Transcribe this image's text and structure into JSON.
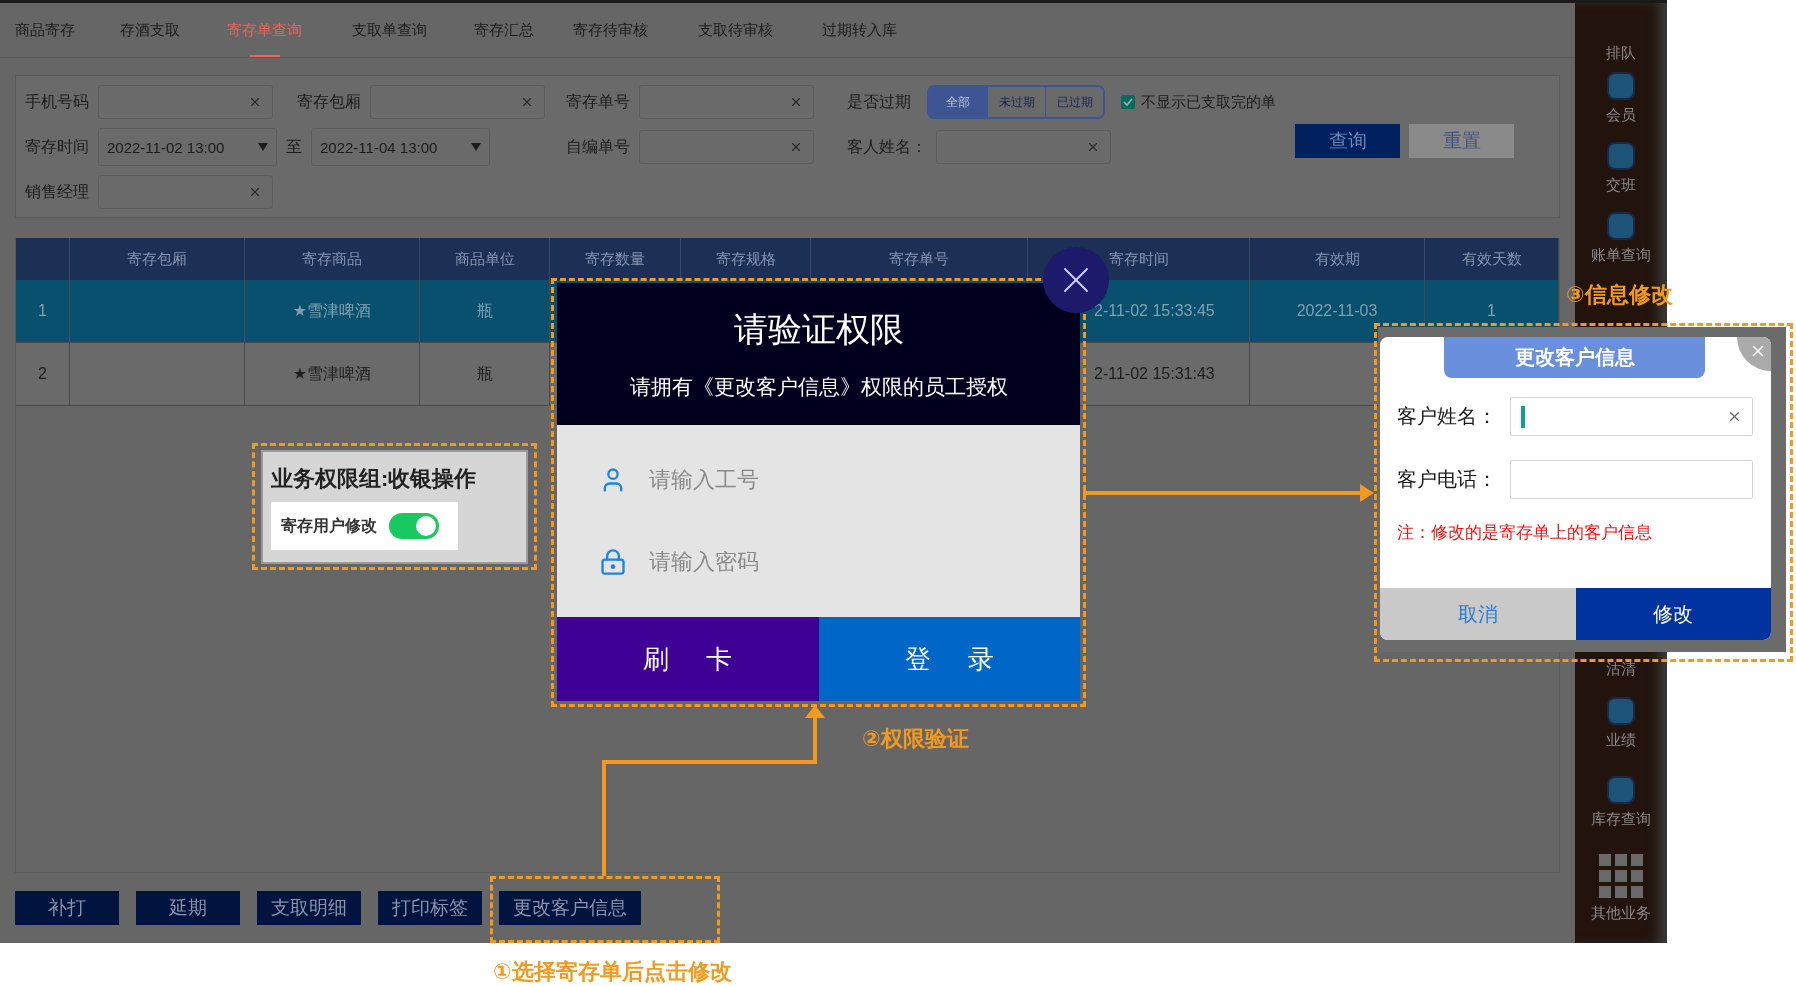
{
  "tabs": [
    {
      "label": "商品寄存",
      "selected": false
    },
    {
      "label": "存酒支取",
      "selected": false
    },
    {
      "label": "寄存单查询",
      "selected": true
    },
    {
      "label": "支取单查询",
      "selected": false
    },
    {
      "label": "寄存汇总",
      "selected": false
    },
    {
      "label": "寄存待审核",
      "selected": false
    },
    {
      "label": "支取待审核",
      "selected": false
    },
    {
      "label": "过期转入库",
      "selected": false
    }
  ],
  "filters": {
    "phone": {
      "label": "手机号码"
    },
    "room": {
      "label": "寄存包厢"
    },
    "order_no": {
      "label": "寄存单号"
    },
    "expired": {
      "label": "是否过期",
      "options": [
        {
          "label": "全部",
          "selected": true
        },
        {
          "label": "未过期",
          "selected": false
        },
        {
          "label": "已过期",
          "selected": false
        }
      ]
    },
    "hide_done": {
      "label": "不显示已支取完的单",
      "checked": true
    },
    "time": {
      "label": "寄存时间",
      "from": "2022-11-02 13:00",
      "separator": "至",
      "to": "2022-11-04 13:00"
    },
    "custom_no": {
      "label": "自编单号"
    },
    "guest": {
      "label": "客人姓名："
    },
    "manager": {
      "label": "销售经理"
    },
    "buttons": [
      "查询",
      "重置"
    ]
  },
  "table": {
    "columns": [
      "寄存包厢",
      "寄存商品",
      "商品单位",
      "寄存数量",
      "寄存规格",
      "寄存单号",
      "寄存时间",
      "有效期",
      "有效天数"
    ],
    "rows": [
      {
        "selected": true,
        "cells": {
          "number": "1",
          "product": "★雪津啤酒",
          "unit": "瓶",
          "time": "2-11-02 15:33:45",
          "valid_until": "2022-11-03",
          "days": "1"
        }
      },
      {
        "selected": false,
        "cells": {
          "number": "2",
          "product": "★雪津啤酒",
          "unit": "瓶",
          "time": "2-11-02 15:31:43"
        }
      }
    ]
  },
  "actions": [
    "补打",
    "延期",
    "支取明细",
    "打印标签",
    "更改客户信息"
  ],
  "sidebar": {
    "top_items": [
      "排队",
      "会员",
      "交班",
      "账单查询"
    ],
    "bottom_items": [
      "沽清",
      "业绩",
      "库存查询"
    ],
    "more": "其他业务"
  },
  "permission_card": {
    "title": "业务权限组:收银操作",
    "setting": {
      "label": "寄存用户修改",
      "on": true
    }
  },
  "auth_dialog": {
    "title": "请验证权限",
    "subtitle": "请拥有《更改客户信息》权限的员工授权",
    "id_placeholder": "请输入工号",
    "password_placeholder": "请输入密码",
    "buttons": [
      "刷 卡",
      "登 录"
    ]
  },
  "edit_dialog": {
    "title": "更改客户信息",
    "name_label": "客户姓名：",
    "phone_label": "客户电话：",
    "note": "注：修改的是寄存单上的客户信息",
    "cancel": "取消",
    "confirm": "修改"
  },
  "annotations": [
    "①选择寄存单后点击修改",
    "②权限验证",
    "③信息修改"
  ]
}
